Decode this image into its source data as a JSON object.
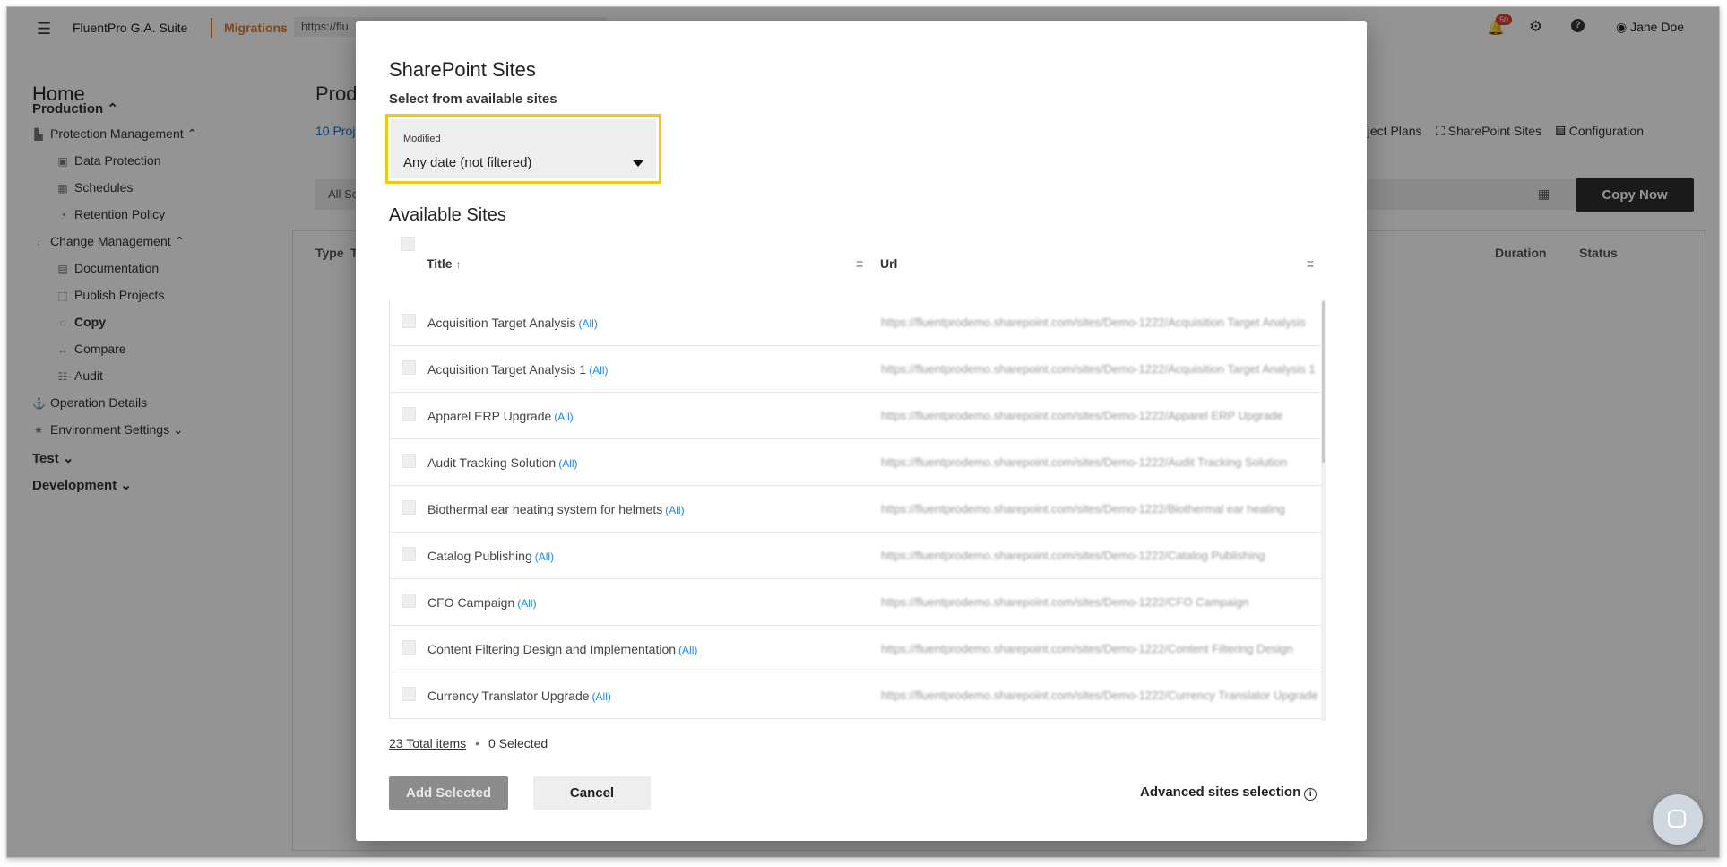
{
  "topbar": {
    "app_name": "FluentPro G.A. Suite",
    "section": "Migrations",
    "url": "https://flu",
    "notifications": "50",
    "user": "Jane Doe"
  },
  "sidebar": {
    "home": "Home",
    "items": [
      {
        "label": "Production",
        "type": "group"
      },
      {
        "label": "Protection Management",
        "type": "l1"
      },
      {
        "label": "Data Protection",
        "type": "l2"
      },
      {
        "label": "Schedules",
        "type": "l2"
      },
      {
        "label": "Retention Policy",
        "type": "l2"
      },
      {
        "label": "Change Management",
        "type": "l1"
      },
      {
        "label": "Documentation",
        "type": "l2"
      },
      {
        "label": "Publish Projects",
        "type": "l2"
      },
      {
        "label": "Copy",
        "type": "l2"
      },
      {
        "label": "Compare",
        "type": "l2"
      },
      {
        "label": "Audit",
        "type": "l2"
      },
      {
        "label": "Operation Details",
        "type": "l1"
      },
      {
        "label": "Environment Settings",
        "type": "l1"
      },
      {
        "label": "Test",
        "type": "group"
      },
      {
        "label": "Development",
        "type": "group"
      }
    ]
  },
  "main": {
    "title": "Produ",
    "projects_link": "10 Proje",
    "filter": "All So",
    "nav_project_plans": "oject Plans",
    "nav_sharepoint": "SharePoint Sites",
    "nav_configuration": "Configuration",
    "copy_now": "Copy Now",
    "col_type": "Type",
    "col_t": "T",
    "col_duration": "Duration",
    "col_status": "Status"
  },
  "dialog": {
    "title": "SharePoint Sites",
    "subtitle": "Select from available sites",
    "filter_label": "Modified",
    "filter_value": "Any date (not filtered)",
    "available_title": "Available Sites",
    "col_title": "Title",
    "col_url": "Url",
    "all_label": "(All)",
    "rows": [
      {
        "name": "Acquisition Target Analysis",
        "url": "https://fluentprodemo.sharepoint.com/sites/Demo-1222/Acquisition Target Analysis"
      },
      {
        "name": "Acquisition Target Analysis 1",
        "url": "https://fluentprodemo.sharepoint.com/sites/Demo-1222/Acquisition Target Analysis 1"
      },
      {
        "name": "Apparel ERP Upgrade",
        "url": "https://fluentprodemo.sharepoint.com/sites/Demo-1222/Apparel ERP Upgrade"
      },
      {
        "name": "Audit Tracking Solution",
        "url": "https://fluentprodemo.sharepoint.com/sites/Demo-1222/Audit Tracking Solution"
      },
      {
        "name": "Biothermal ear heating system for helmets",
        "url": "https://fluentprodemo.sharepoint.com/sites/Demo-1222/Biothermal ear heating"
      },
      {
        "name": "Catalog Publishing",
        "url": "https://fluentprodemo.sharepoint.com/sites/Demo-1222/Catalog Publishing"
      },
      {
        "name": "CFO Campaign",
        "url": "https://fluentprodemo.sharepoint.com/sites/Demo-1222/CFO Campaign"
      },
      {
        "name": "Content Filtering Design and Implementation",
        "url": "https://fluentprodemo.sharepoint.com/sites/Demo-1222/Content Filtering Design"
      },
      {
        "name": "Currency Translator Upgrade",
        "url": "https://fluentprodemo.sharepoint.com/sites/Demo-1222/Currency Translator Upgrade"
      }
    ],
    "total_items": "23 Total items",
    "selected": "0 Selected",
    "add_selected": "Add Selected",
    "cancel": "Cancel",
    "advanced": "Advanced sites selection"
  }
}
